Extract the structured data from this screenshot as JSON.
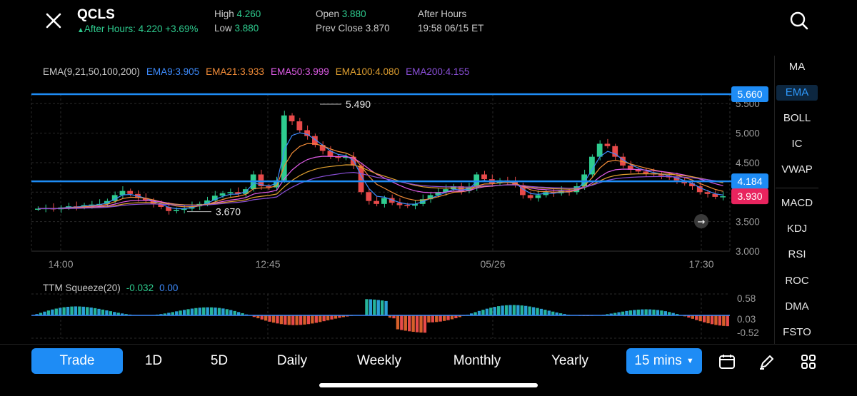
{
  "header": {
    "ticker": "QCLS",
    "after_hours_line": "After Hours: 4.220 +3.69%",
    "high_label": "High",
    "high_value": "4.260",
    "low_label": "Low",
    "low_value": "3.880",
    "open_label": "Open",
    "open_value": "3.880",
    "prev_close_label": "Prev Close",
    "prev_close_value": "3.870",
    "after_hours_label": "After Hours",
    "after_hours_time": "19:58 06/15 ET"
  },
  "ema_legend": {
    "main": "EMA(9,21,50,100,200)",
    "ema9": "EMA9:3.905",
    "ema21": "EMA21:3.933",
    "ema50": "EMA50:3.999",
    "ema100": "EMA100:4.080",
    "ema200": "EMA200:4.155",
    "colors": {
      "ema9": "#3d8bfd",
      "ema21": "#f28c38",
      "ema50": "#e05ce8",
      "ema100": "#e0a030",
      "ema200": "#8a4fd8"
    }
  },
  "price_axis": {
    "ticks": [
      "5.500",
      "5.000",
      "4.500",
      "4.000",
      "3.500",
      "3.000"
    ],
    "line_high_badge": "5.660",
    "line_mid_badge": "4.184",
    "last_price_badge": "3.930",
    "high_label": "5.490",
    "low_label": "3.670"
  },
  "time_axis": [
    "14:00",
    "12:45",
    "05/26",
    "17:30"
  ],
  "ttm": {
    "title": "TTM Squeeze(20)",
    "value1": "-0.032",
    "value2": "0.00",
    "ticks": [
      "0.58",
      "0.03",
      "-0.52"
    ]
  },
  "indicators": {
    "main": [
      "MA",
      "EMA",
      "BOLL",
      "IC",
      "VWAP"
    ],
    "sub": [
      "MACD",
      "KDJ",
      "RSI",
      "ROC",
      "DMA",
      "FSTO"
    ],
    "active": "EMA"
  },
  "bottom_tabs": {
    "trade": "Trade",
    "d1": "1D",
    "d5": "5D",
    "daily": "Daily",
    "weekly": "Weekly",
    "monthly": "Monthly",
    "yearly": "Yearly",
    "interval": "15 mins"
  },
  "colors": {
    "accent": "#1e8cf5",
    "up": "#2ecc8f",
    "down": "#e84a4a",
    "last_price": "#e8245e"
  },
  "chart_data": {
    "type": "candlestick",
    "price_range": [
      3.0,
      5.7
    ],
    "reference_lines": [
      5.66,
      4.184
    ],
    "last_price": 3.93,
    "period_high": 5.49,
    "period_low": 3.67,
    "close_series": [
      3.72,
      3.73,
      3.71,
      3.74,
      3.76,
      3.75,
      3.78,
      3.79,
      3.8,
      3.85,
      3.95,
      4.02,
      3.97,
      3.9,
      3.86,
      3.8,
      3.75,
      3.68,
      3.7,
      3.72,
      3.76,
      3.8,
      3.86,
      3.94,
      3.98,
      4.0,
      3.97,
      4.05,
      4.3,
      4.1,
      4.08,
      4.2,
      5.3,
      5.2,
      5.05,
      4.95,
      4.8,
      4.7,
      4.6,
      4.58,
      4.6,
      4.45,
      4.0,
      3.85,
      3.8,
      3.9,
      3.82,
      3.78,
      3.77,
      3.8,
      3.88,
      3.95,
      4.0,
      4.05,
      4.1,
      4.02,
      4.08,
      4.3,
      4.22,
      4.15,
      4.2,
      4.18,
      4.12,
      3.95,
      3.9,
      3.95,
      4.0,
      3.98,
      4.02,
      4.0,
      4.1,
      4.3,
      4.6,
      4.82,
      4.78,
      4.6,
      4.45,
      4.38,
      4.35,
      4.32,
      4.3,
      4.28,
      4.25,
      4.2,
      4.15,
      4.1,
      4.0,
      3.97,
      3.92,
      3.93
    ]
  }
}
